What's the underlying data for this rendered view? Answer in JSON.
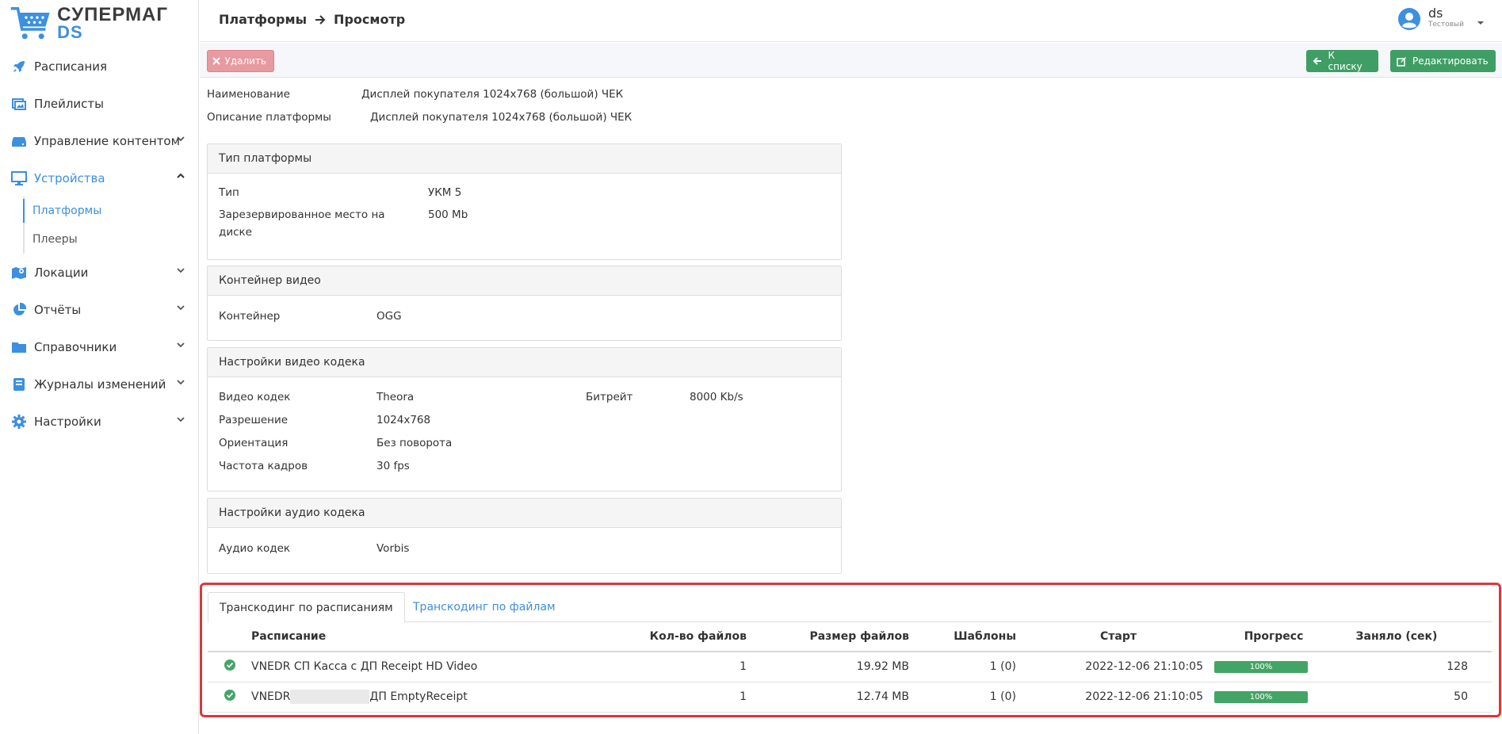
{
  "brand": {
    "line1": "СУПЕРМАГ",
    "line2": "DS"
  },
  "sidebar": {
    "items": [
      {
        "label": "Расписания",
        "icon": "rocket-icon"
      },
      {
        "label": "Плейлисты",
        "icon": "playlist-icon"
      },
      {
        "label": "Управление контентом",
        "icon": "storage-icon"
      },
      {
        "label": "Устройства",
        "icon": "monitor-icon"
      },
      {
        "label": "Локации",
        "icon": "map-icon"
      },
      {
        "label": "Отчёты",
        "icon": "pie-chart-icon"
      },
      {
        "label": "Справочники",
        "icon": "folder-icon"
      },
      {
        "label": "Журналы изменений",
        "icon": "book-icon"
      },
      {
        "label": "Настройки",
        "icon": "gear-icon"
      }
    ],
    "subitems": [
      {
        "label": "Платформы"
      },
      {
        "label": "Плееры"
      }
    ]
  },
  "header": {
    "breadcrumb": [
      "Платформы",
      "Просмотр"
    ],
    "user_name": "ds",
    "user_role": "Тестовый"
  },
  "toolbar": {
    "delete_label": "Удалить",
    "tolist_label": "К списку",
    "edit_label": "Редактировать"
  },
  "details": {
    "name_label": "Наименование",
    "name_value": "Дисплей покупателя 1024x768 (большой) ЧЕК",
    "desc_label": "Описание платформы",
    "desc_value": "Дисплей покупателя 1024x768 (большой) ЧЕК"
  },
  "platform_type": {
    "title": "Тип платформы",
    "type_label": "Тип",
    "type_value": "УКМ 5",
    "reserved_label_1": "Зарезервированное место на",
    "reserved_label_2": "диске",
    "reserved_value": "500 Mb"
  },
  "video_container": {
    "title": "Контейнер видео",
    "container_label": "Контейнер",
    "container_value": "OGG"
  },
  "video_codec": {
    "title": "Настройки видео кодека",
    "codec_label": "Видео кодек",
    "codec_value": "Theora",
    "bitrate_label": "Битрейт",
    "bitrate_value": "8000 Kb/s",
    "resolution_label": "Разрешение",
    "resolution_value": "1024x768",
    "orientation_label": "Ориентация",
    "orientation_value": "Без поворота",
    "fps_label": "Частота кадров",
    "fps_value": "30 fps"
  },
  "audio_codec": {
    "title": "Настройки аудио кодека",
    "codec_label": "Аудио кодек",
    "codec_value": "Vorbis"
  },
  "tabs": [
    {
      "label": "Транскодинг по расписаниям"
    },
    {
      "label": "Транскодинг по файлам"
    }
  ],
  "table": {
    "columns": [
      "Расписание",
      "Кол-во файлов",
      "Размер файлов",
      "Шаблоны",
      "Старт",
      "Прогресс",
      "Заняло (сек)"
    ],
    "rows": [
      {
        "schedule": "VNEDR СП Касса с ДП Receipt HD Video",
        "files": "1",
        "size": "19.92 MB",
        "templates": "1 (0)",
        "start": "2022-12-06 21:10:05",
        "progress_label": "100%",
        "progress": 1.0,
        "took": "128"
      },
      {
        "schedule_prefix": "VNEDR",
        "schedule_suffix": "ДП EmptyReceipt",
        "files": "1",
        "size": "12.74 MB",
        "templates": "1 (0)",
        "start": "2022-12-06 21:10:05",
        "progress_label": "100%",
        "progress": 1.0,
        "took": "50"
      }
    ]
  },
  "colors": {
    "accent": "#3d8fe0",
    "success": "#43a565",
    "danger": "#e79a9f",
    "highlight": "#e0343a"
  }
}
